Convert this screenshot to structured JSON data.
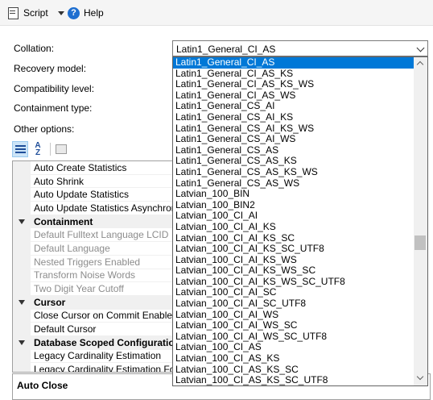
{
  "toolbar": {
    "script_label": "Script",
    "help_label": "Help"
  },
  "form": {
    "collation_label": "Collation:",
    "recovery_label": "Recovery model:",
    "compat_label": "Compatibility level:",
    "containment_label": "Containment type:",
    "other_label": "Other options:",
    "collation_value": "Latin1_General_CI_AS"
  },
  "grid_rows": [
    {
      "label": "Auto Create Statistics",
      "kind": "prop"
    },
    {
      "label": "Auto Shrink",
      "kind": "prop"
    },
    {
      "label": "Auto Update Statistics",
      "kind": "prop"
    },
    {
      "label": "Auto Update Statistics Asynchronously",
      "kind": "prop"
    },
    {
      "label": "Containment",
      "kind": "cat"
    },
    {
      "label": "Default Fulltext Language LCID",
      "kind": "dis"
    },
    {
      "label": "Default Language",
      "kind": "dis"
    },
    {
      "label": "Nested Triggers Enabled",
      "kind": "dis"
    },
    {
      "label": "Transform Noise Words",
      "kind": "dis"
    },
    {
      "label": "Two Digit Year Cutoff",
      "kind": "dis"
    },
    {
      "label": "Cursor",
      "kind": "cat"
    },
    {
      "label": "Close Cursor on Commit Enabled",
      "kind": "prop"
    },
    {
      "label": "Default Cursor",
      "kind": "prop"
    },
    {
      "label": "Database Scoped Configurations",
      "kind": "cat"
    },
    {
      "label": "Legacy Cardinality Estimation",
      "kind": "prop"
    },
    {
      "label": "Legacy Cardinality Estimation For Secondary",
      "kind": "prop"
    }
  ],
  "description": {
    "title": "Auto Close"
  },
  "dropdown": {
    "selected_index": 0,
    "items": [
      "Latin1_General_CI_AS",
      "Latin1_General_CI_AS_KS",
      "Latin1_General_CI_AS_KS_WS",
      "Latin1_General_CI_AS_WS",
      "Latin1_General_CS_AI",
      "Latin1_General_CS_AI_KS",
      "Latin1_General_CS_AI_KS_WS",
      "Latin1_General_CS_AI_WS",
      "Latin1_General_CS_AS",
      "Latin1_General_CS_AS_KS",
      "Latin1_General_CS_AS_KS_WS",
      "Latin1_General_CS_AS_WS",
      "Latvian_100_BIN",
      "Latvian_100_BIN2",
      "Latvian_100_CI_AI",
      "Latvian_100_CI_AI_KS",
      "Latvian_100_CI_AI_KS_SC",
      "Latvian_100_CI_AI_KS_SC_UTF8",
      "Latvian_100_CI_AI_KS_WS",
      "Latvian_100_CI_AI_KS_WS_SC",
      "Latvian_100_CI_AI_KS_WS_SC_UTF8",
      "Latvian_100_CI_AI_SC",
      "Latvian_100_CI_AI_SC_UTF8",
      "Latvian_100_CI_AI_WS",
      "Latvian_100_CI_AI_WS_SC",
      "Latvian_100_CI_AI_WS_SC_UTF8",
      "Latvian_100_CI_AS",
      "Latvian_100_CI_AS_KS",
      "Latvian_100_CI_AS_KS_SC",
      "Latvian_100_CI_AS_KS_SC_UTF8"
    ]
  },
  "icons": {
    "script": "script-icon",
    "dropdown": "chevron-down-icon",
    "help": "help-icon",
    "categorized": "categorized-icon",
    "alphabetical": "sort-alphabetical-icon",
    "property_pages": "property-pages-icon",
    "collapse": "collapse-triangle-icon"
  },
  "colors": {
    "selection": "#0078d7",
    "help_icon": "#1f6fd0",
    "disabled_text": "#8c8c8c"
  }
}
